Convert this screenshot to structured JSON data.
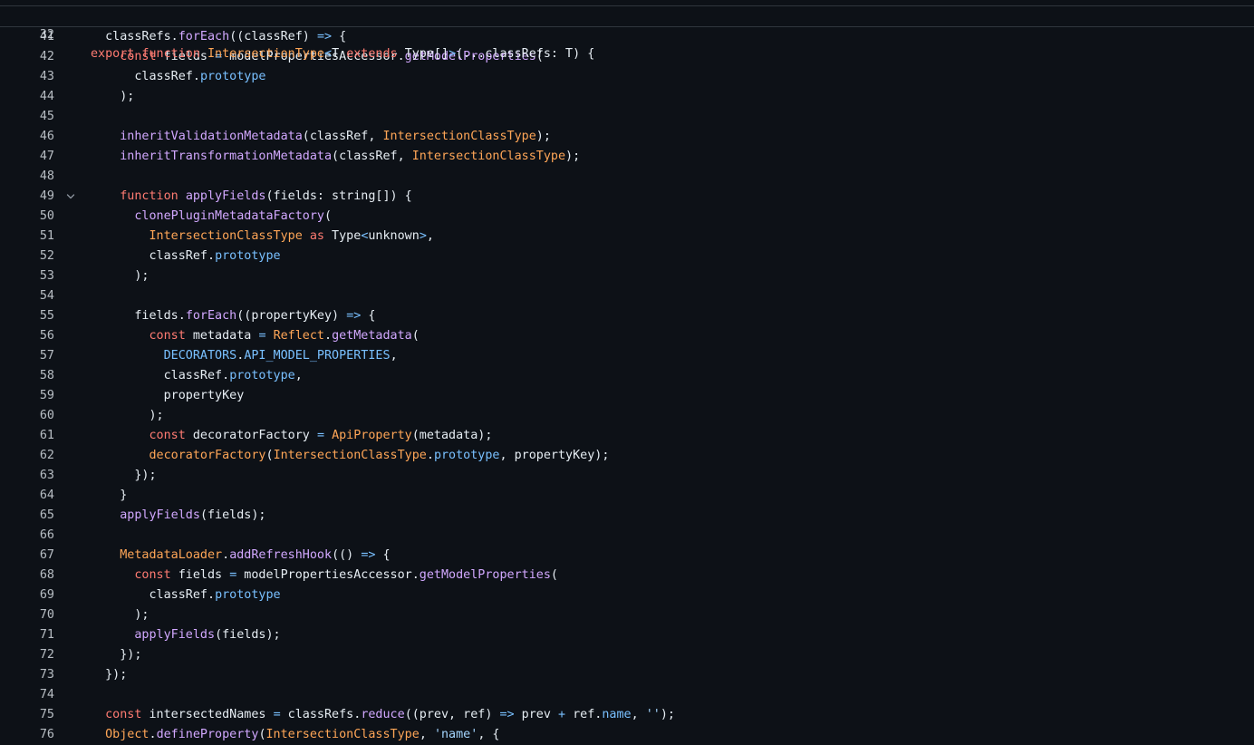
{
  "sticky_line": {
    "number": "32",
    "tokens": [
      {
        "t": "export function ",
        "c": "k"
      },
      {
        "t": "IntersectionType",
        "c": "t"
      },
      {
        "t": "<",
        "c": "c"
      },
      {
        "t": "T ",
        "c": ""
      },
      {
        "t": "extends ",
        "c": "k"
      },
      {
        "t": "Type[]",
        "c": ""
      },
      {
        "t": ">",
        "c": "c"
      },
      {
        "t": "(...classRefs: T) {",
        "c": ""
      }
    ]
  },
  "lines": [
    {
      "n": "41",
      "tokens": [
        {
          "t": "  classRefs.",
          "c": ""
        },
        {
          "t": "forEach",
          "c": "f"
        },
        {
          "t": "((classRef) ",
          "c": ""
        },
        {
          "t": "=>",
          "c": "c"
        },
        {
          "t": " {",
          "c": ""
        }
      ]
    },
    {
      "n": "42",
      "tokens": [
        {
          "t": "    ",
          "c": ""
        },
        {
          "t": "const",
          "c": "k"
        },
        {
          "t": " fields ",
          "c": ""
        },
        {
          "t": "=",
          "c": "c"
        },
        {
          "t": " modelPropertiesAccessor.",
          "c": ""
        },
        {
          "t": "getModelProperties",
          "c": "f"
        },
        {
          "t": "(",
          "c": ""
        }
      ]
    },
    {
      "n": "43",
      "tokens": [
        {
          "t": "      classRef.",
          "c": ""
        },
        {
          "t": "prototype",
          "c": "c"
        }
      ]
    },
    {
      "n": "44",
      "tokens": [
        {
          "t": "    );",
          "c": ""
        }
      ]
    },
    {
      "n": "45",
      "tokens": []
    },
    {
      "n": "46",
      "tokens": [
        {
          "t": "    ",
          "c": ""
        },
        {
          "t": "inheritValidationMetadata",
          "c": "f"
        },
        {
          "t": "(classRef, ",
          "c": ""
        },
        {
          "t": "IntersectionClassType",
          "c": "t"
        },
        {
          "t": ");",
          "c": ""
        }
      ]
    },
    {
      "n": "47",
      "tokens": [
        {
          "t": "    ",
          "c": ""
        },
        {
          "t": "inheritTransformationMetadata",
          "c": "f"
        },
        {
          "t": "(classRef, ",
          "c": ""
        },
        {
          "t": "IntersectionClassType",
          "c": "t"
        },
        {
          "t": ");",
          "c": ""
        }
      ]
    },
    {
      "n": "48",
      "tokens": []
    },
    {
      "n": "49",
      "fold": true,
      "tokens": [
        {
          "t": "    ",
          "c": ""
        },
        {
          "t": "function",
          "c": "k"
        },
        {
          "t": " ",
          "c": ""
        },
        {
          "t": "applyFields",
          "c": "f"
        },
        {
          "t": "(fields: string[]) {",
          "c": ""
        }
      ]
    },
    {
      "n": "50",
      "tokens": [
        {
          "t": "      ",
          "c": ""
        },
        {
          "t": "clonePluginMetadataFactory",
          "c": "f"
        },
        {
          "t": "(",
          "c": ""
        }
      ]
    },
    {
      "n": "51",
      "tokens": [
        {
          "t": "        ",
          "c": ""
        },
        {
          "t": "IntersectionClassType",
          "c": "t"
        },
        {
          "t": " ",
          "c": ""
        },
        {
          "t": "as",
          "c": "k"
        },
        {
          "t": " Type",
          "c": ""
        },
        {
          "t": "<",
          "c": "c"
        },
        {
          "t": "unknown",
          "c": ""
        },
        {
          "t": ">",
          "c": "c"
        },
        {
          "t": ",",
          "c": ""
        }
      ]
    },
    {
      "n": "52",
      "tokens": [
        {
          "t": "        classRef.",
          "c": ""
        },
        {
          "t": "prototype",
          "c": "c"
        }
      ]
    },
    {
      "n": "53",
      "tokens": [
        {
          "t": "      );",
          "c": ""
        }
      ]
    },
    {
      "n": "54",
      "tokens": []
    },
    {
      "n": "55",
      "tokens": [
        {
          "t": "      fields.",
          "c": ""
        },
        {
          "t": "forEach",
          "c": "f"
        },
        {
          "t": "((propertyKey) ",
          "c": ""
        },
        {
          "t": "=>",
          "c": "c"
        },
        {
          "t": " {",
          "c": ""
        }
      ]
    },
    {
      "n": "56",
      "tokens": [
        {
          "t": "        ",
          "c": ""
        },
        {
          "t": "const",
          "c": "k"
        },
        {
          "t": " metadata ",
          "c": ""
        },
        {
          "t": "=",
          "c": "c"
        },
        {
          "t": " ",
          "c": ""
        },
        {
          "t": "Reflect",
          "c": "t"
        },
        {
          "t": ".",
          "c": ""
        },
        {
          "t": "getMetadata",
          "c": "f"
        },
        {
          "t": "(",
          "c": ""
        }
      ]
    },
    {
      "n": "57",
      "tokens": [
        {
          "t": "          ",
          "c": ""
        },
        {
          "t": "DECORATORS",
          "c": "c"
        },
        {
          "t": ".",
          "c": ""
        },
        {
          "t": "API_MODEL_PROPERTIES",
          "c": "c"
        },
        {
          "t": ",",
          "c": ""
        }
      ]
    },
    {
      "n": "58",
      "tokens": [
        {
          "t": "          classRef.",
          "c": ""
        },
        {
          "t": "prototype",
          "c": "c"
        },
        {
          "t": ",",
          "c": ""
        }
      ]
    },
    {
      "n": "59",
      "tokens": [
        {
          "t": "          propertyKey",
          "c": ""
        }
      ]
    },
    {
      "n": "60",
      "tokens": [
        {
          "t": "        );",
          "c": ""
        }
      ]
    },
    {
      "n": "61",
      "tokens": [
        {
          "t": "        ",
          "c": ""
        },
        {
          "t": "const",
          "c": "k"
        },
        {
          "t": " decoratorFactory ",
          "c": ""
        },
        {
          "t": "=",
          "c": "c"
        },
        {
          "t": " ",
          "c": ""
        },
        {
          "t": "ApiProperty",
          "c": "t"
        },
        {
          "t": "(metadata);",
          "c": ""
        }
      ]
    },
    {
      "n": "62",
      "tokens": [
        {
          "t": "        ",
          "c": ""
        },
        {
          "t": "decoratorFactory",
          "c": "t"
        },
        {
          "t": "(",
          "c": ""
        },
        {
          "t": "IntersectionClassType",
          "c": "t"
        },
        {
          "t": ".",
          "c": ""
        },
        {
          "t": "prototype",
          "c": "c"
        },
        {
          "t": ", propertyKey);",
          "c": ""
        }
      ]
    },
    {
      "n": "63",
      "tokens": [
        {
          "t": "      });",
          "c": ""
        }
      ]
    },
    {
      "n": "64",
      "tokens": [
        {
          "t": "    }",
          "c": ""
        }
      ]
    },
    {
      "n": "65",
      "tokens": [
        {
          "t": "    ",
          "c": ""
        },
        {
          "t": "applyFields",
          "c": "f"
        },
        {
          "t": "(fields);",
          "c": ""
        }
      ]
    },
    {
      "n": "66",
      "tokens": []
    },
    {
      "n": "67",
      "tokens": [
        {
          "t": "    ",
          "c": ""
        },
        {
          "t": "MetadataLoader",
          "c": "t"
        },
        {
          "t": ".",
          "c": ""
        },
        {
          "t": "addRefreshHook",
          "c": "f"
        },
        {
          "t": "(() ",
          "c": ""
        },
        {
          "t": "=>",
          "c": "c"
        },
        {
          "t": " {",
          "c": ""
        }
      ]
    },
    {
      "n": "68",
      "tokens": [
        {
          "t": "      ",
          "c": ""
        },
        {
          "t": "const",
          "c": "k"
        },
        {
          "t": " fields ",
          "c": ""
        },
        {
          "t": "=",
          "c": "c"
        },
        {
          "t": " modelPropertiesAccessor.",
          "c": ""
        },
        {
          "t": "getModelProperties",
          "c": "f"
        },
        {
          "t": "(",
          "c": ""
        }
      ]
    },
    {
      "n": "69",
      "tokens": [
        {
          "t": "        classRef.",
          "c": ""
        },
        {
          "t": "prototype",
          "c": "c"
        }
      ]
    },
    {
      "n": "70",
      "tokens": [
        {
          "t": "      );",
          "c": ""
        }
      ]
    },
    {
      "n": "71",
      "tokens": [
        {
          "t": "      ",
          "c": ""
        },
        {
          "t": "applyFields",
          "c": "f"
        },
        {
          "t": "(fields);",
          "c": ""
        }
      ]
    },
    {
      "n": "72",
      "tokens": [
        {
          "t": "    });",
          "c": ""
        }
      ]
    },
    {
      "n": "73",
      "tokens": [
        {
          "t": "  });",
          "c": ""
        }
      ]
    },
    {
      "n": "74",
      "tokens": []
    },
    {
      "n": "75",
      "tokens": [
        {
          "t": "  ",
          "c": ""
        },
        {
          "t": "const",
          "c": "k"
        },
        {
          "t": " intersectedNames ",
          "c": ""
        },
        {
          "t": "=",
          "c": "c"
        },
        {
          "t": " classRefs.",
          "c": ""
        },
        {
          "t": "reduce",
          "c": "f"
        },
        {
          "t": "((prev, ref) ",
          "c": ""
        },
        {
          "t": "=>",
          "c": "c"
        },
        {
          "t": " prev ",
          "c": ""
        },
        {
          "t": "+",
          "c": "c"
        },
        {
          "t": " ref.",
          "c": ""
        },
        {
          "t": "name",
          "c": "c"
        },
        {
          "t": ", ",
          "c": ""
        },
        {
          "t": "''",
          "c": "s"
        },
        {
          "t": ");",
          "c": ""
        }
      ]
    },
    {
      "n": "76",
      "tokens": [
        {
          "t": "  ",
          "c": ""
        },
        {
          "t": "Object",
          "c": "t"
        },
        {
          "t": ".",
          "c": ""
        },
        {
          "t": "defineProperty",
          "c": "f"
        },
        {
          "t": "(",
          "c": ""
        },
        {
          "t": "IntersectionClassType",
          "c": "t"
        },
        {
          "t": ", ",
          "c": ""
        },
        {
          "t": "'name'",
          "c": "s"
        },
        {
          "t": ", {",
          "c": ""
        }
      ]
    }
  ]
}
